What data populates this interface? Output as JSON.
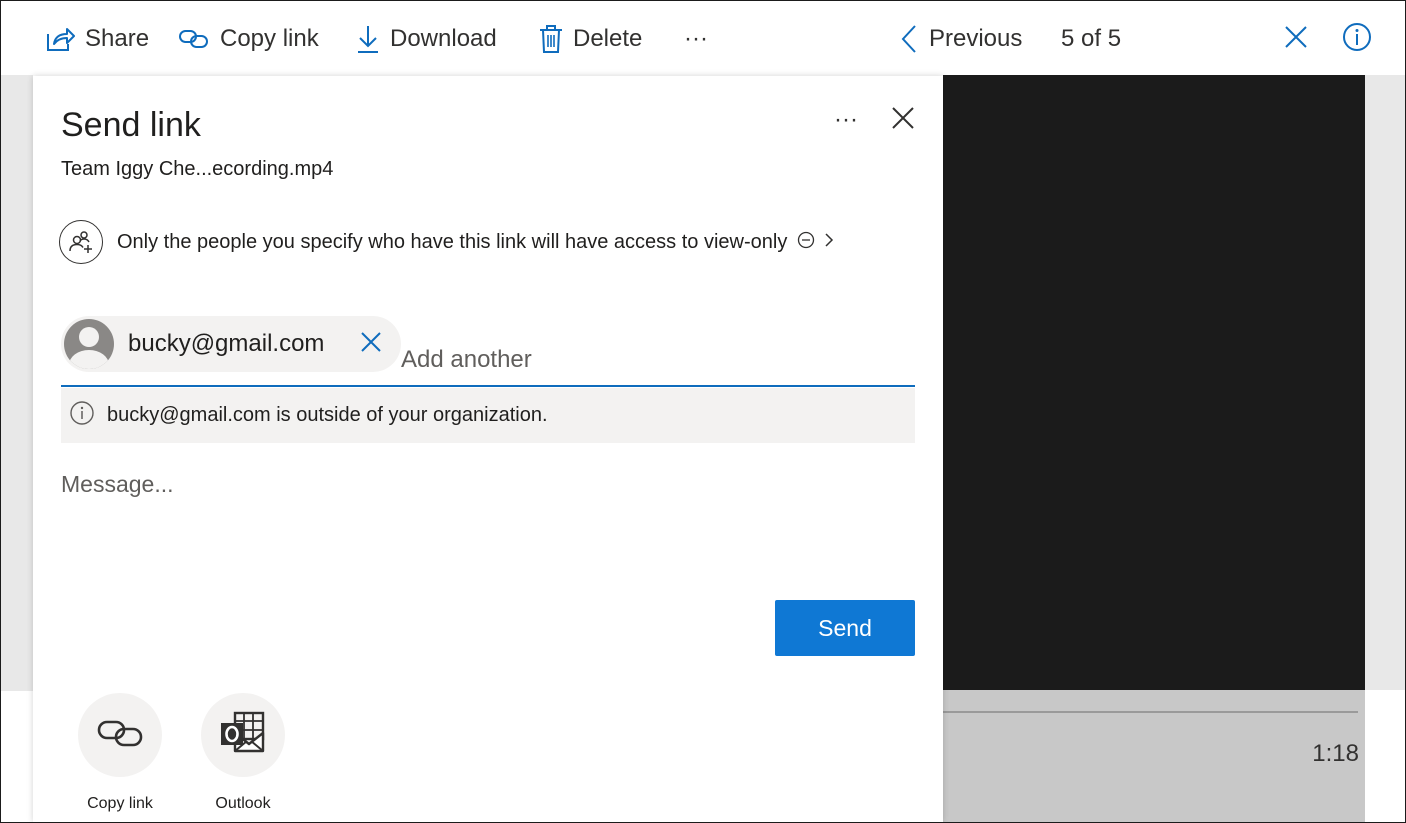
{
  "toolbar": {
    "share_label": "Share",
    "copy_link_label": "Copy link",
    "download_label": "Download",
    "delete_label": "Delete",
    "more_label": "···",
    "previous_label": "Previous",
    "counter": "5 of 5"
  },
  "player": {
    "time": "1:18"
  },
  "panel": {
    "title": "Send link",
    "more_label": "···",
    "filename": "Team Iggy Che...ecording.mp4",
    "access_text": "Only the people you specify who have this link will have access to view-only",
    "recipient": {
      "email": "bucky@gmail.com"
    },
    "add_placeholder": "Add another",
    "warning_text": "bucky@gmail.com is outside of your organization.",
    "message_placeholder": "Message...",
    "send_label": "Send",
    "share_options": [
      {
        "label": "Copy link",
        "icon": "link-icon"
      },
      {
        "label": "Outlook",
        "icon": "outlook-icon"
      }
    ]
  },
  "colors": {
    "accent": "#0f78d4",
    "icon_blue": "#0f6cbd",
    "video_bg": "#1b1b1b"
  }
}
